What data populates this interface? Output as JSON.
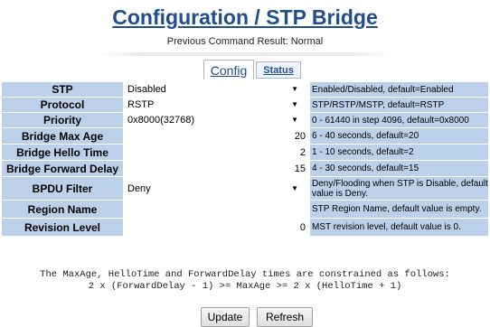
{
  "page": {
    "title": "Configuration / STP Bridge",
    "subtitle": "Previous Command Result: Normal"
  },
  "tabs": {
    "config": "Config",
    "status": "Status"
  },
  "rows": [
    {
      "label": "STP",
      "type": "select",
      "value": "Disabled",
      "desc": "Enabled/Disabled, default=Enabled"
    },
    {
      "label": "Protocol",
      "type": "select",
      "value": "RSTP",
      "desc": "STP/RSTP/MSTP, default=RSTP"
    },
    {
      "label": "Priority",
      "type": "select",
      "value": "0x8000(32768)",
      "desc": "0 - 61440 in step 4096, default=0x8000"
    },
    {
      "label": "Bridge Max Age",
      "type": "input",
      "value": "20",
      "desc": "6 - 40 seconds, default=20"
    },
    {
      "label": "Bridge Hello Time",
      "type": "input",
      "value": "2",
      "desc": "1 - 10 seconds, default=2"
    },
    {
      "label": "Bridge Forward Delay",
      "type": "input",
      "value": "15",
      "desc": "4 - 30 seconds, default=15"
    },
    {
      "label": "BPDU Filter",
      "type": "select",
      "value": "Deny",
      "desc": "Deny/Flooding when STP is Disable, default value is Deny."
    },
    {
      "label": "Region Name",
      "type": "input",
      "value": "",
      "desc": "STP Region Name, default value is empty."
    },
    {
      "label": "Revision Level",
      "type": "input",
      "value": "0",
      "desc": "MST revision level, default value is 0."
    }
  ],
  "note": {
    "line1": "The MaxAge, HelloTime and ForwardDelay times are constrained as follows:",
    "line2": "2 x (ForwardDelay - 1) >= MaxAge >= 2 x (HelloTime + 1)"
  },
  "buttons": {
    "update": "Update",
    "refresh": "Refresh"
  },
  "colors": {
    "title": "#1f4e8c",
    "label_bg": "#bcd0ea"
  }
}
